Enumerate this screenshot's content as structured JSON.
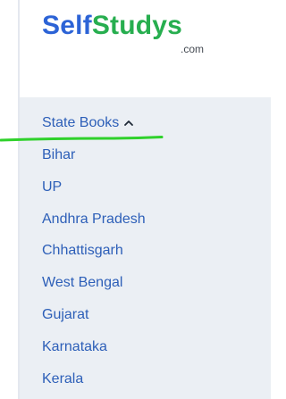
{
  "colors": {
    "logo_blue": "#2c63d6",
    "logo_green": "#27ae4f",
    "link_blue": "#2d5fb8",
    "panel_bg": "#ebeff4",
    "annotation_green": "#2fd12b"
  },
  "brand": {
    "name_part1": "Self",
    "name_part2": "Studys",
    "domain": ".com"
  },
  "menu": {
    "header_label": "State Books",
    "header_icon": "chevron-up-icon",
    "items": [
      "Bihar",
      "UP",
      "Andhra Pradesh",
      "Chhattisgarh",
      "West Bengal",
      "Gujarat",
      "Karnataka",
      "Kerala"
    ]
  }
}
